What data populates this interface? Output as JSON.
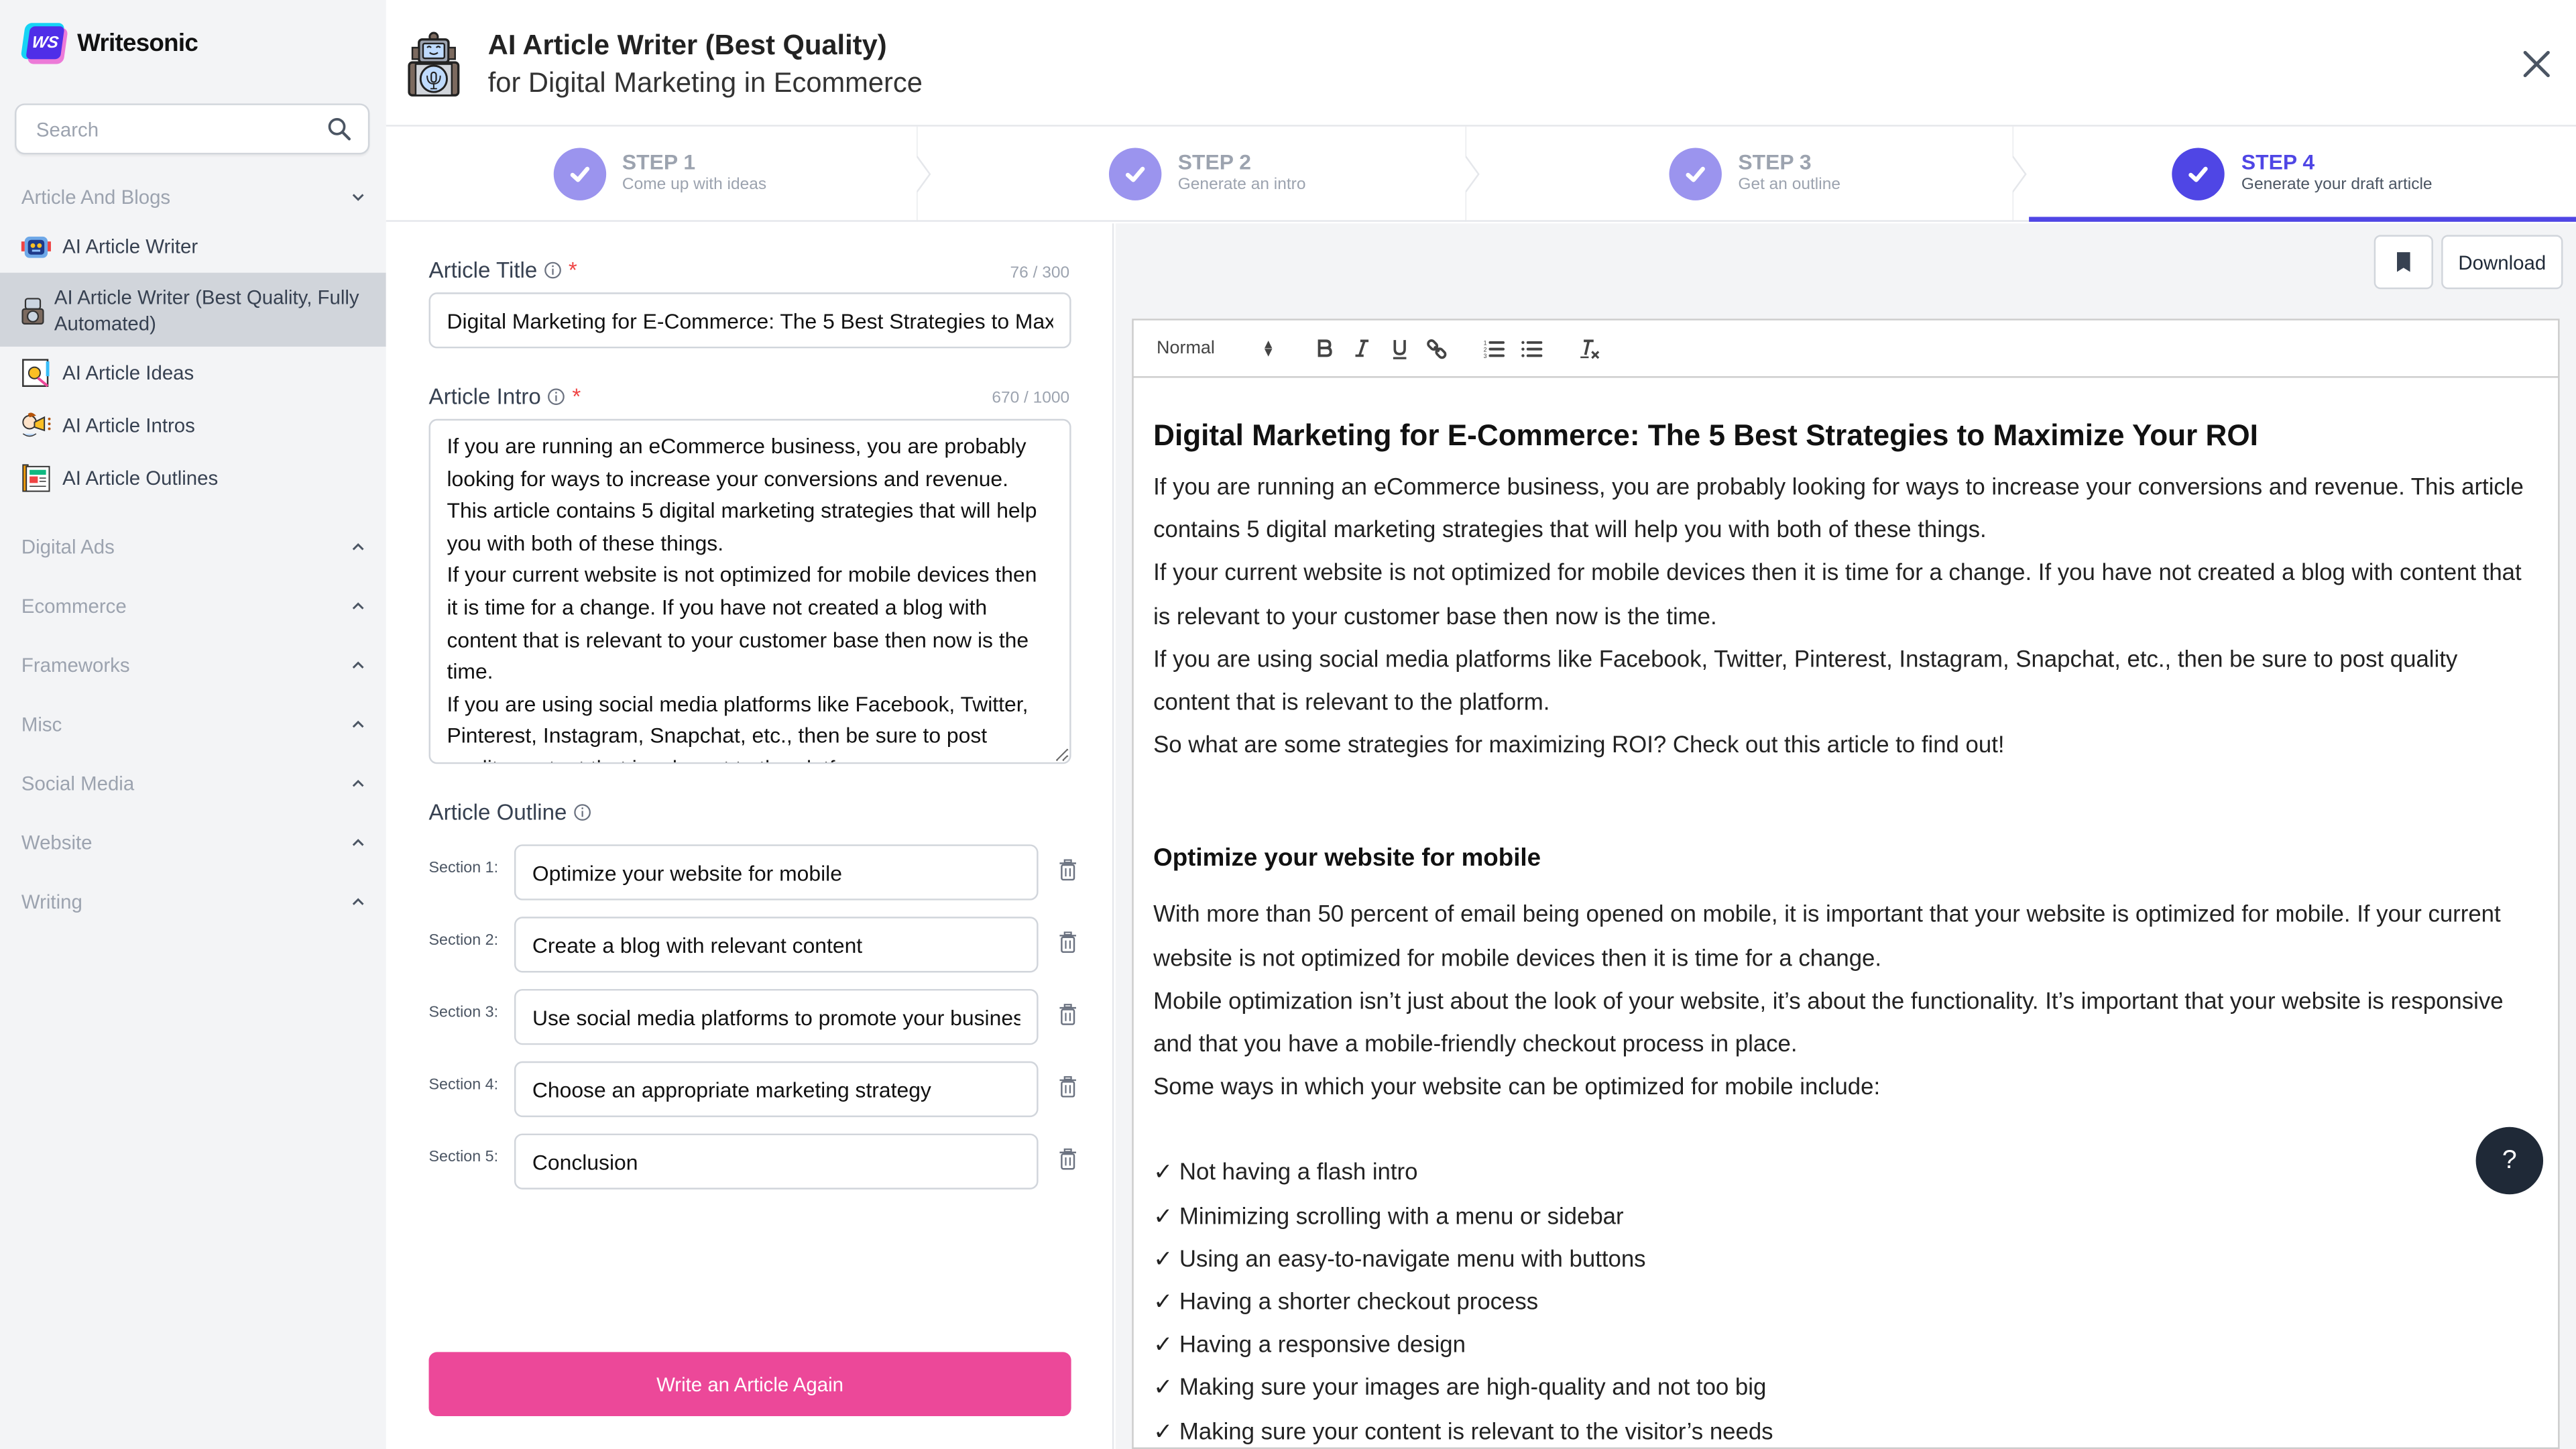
{
  "app": {
    "name": "Writesonic",
    "logo_text": "WS"
  },
  "sidebar": {
    "search_placeholder": "Search",
    "groups": [
      {
        "label": "Article And Blogs",
        "expanded": true
      },
      {
        "label": "Digital Ads",
        "expanded": false
      },
      {
        "label": "Ecommerce",
        "expanded": false
      },
      {
        "label": "Frameworks",
        "expanded": false
      },
      {
        "label": "Misc",
        "expanded": false
      },
      {
        "label": "Social Media",
        "expanded": false
      },
      {
        "label": "Website",
        "expanded": false
      },
      {
        "label": "Writing",
        "expanded": false
      }
    ],
    "items": [
      {
        "label": "AI Article Writer",
        "icon": "robot-icon"
      },
      {
        "label": "AI Article Writer (Best Quality, Fully Automated)",
        "icon": "robot-podcast-icon",
        "active": true
      },
      {
        "label": "AI Article Ideas",
        "icon": "idea-notebook-icon"
      },
      {
        "label": "AI Article Intros",
        "icon": "megaphone-icon"
      },
      {
        "label": "AI Article Outlines",
        "icon": "newspaper-icon"
      }
    ]
  },
  "header": {
    "title": "AI Article Writer (Best Quality)",
    "subtitle": "for Digital Marketing in Ecommerce"
  },
  "steps": [
    {
      "title": "STEP 1",
      "desc": "Come up with ideas",
      "done": true
    },
    {
      "title": "STEP 2",
      "desc": "Generate an intro",
      "done": true
    },
    {
      "title": "STEP 3",
      "desc": "Get an outline",
      "done": true
    },
    {
      "title": "STEP 4",
      "desc": "Generate your draft article",
      "done": true,
      "active": true
    }
  ],
  "form": {
    "title_label": "Article Title",
    "title_count": "76 / 300",
    "title_value": "Digital Marketing for E-Commerce: The 5 Best Strategies to Maximize Your ROI",
    "intro_label": "Article Intro",
    "intro_count": "670 / 1000",
    "intro_value": "If you are running an eCommerce business, you are probably looking for ways to increase your conversions and revenue. This article contains 5 digital marketing strategies that will help you with both of these things.\nIf your current website is not optimized for mobile devices then it is time for a change. If you have not created a blog with content that is relevant to your customer base then now is the time.\nIf you are using social media platforms like Facebook, Twitter, Pinterest, Instagram, Snapchat, etc., then be sure to post quality content that is relevant to the platform.\nSo what are some strategies for maximizing ROI? Check out this article to find out!",
    "outline_label": "Article Outline",
    "sections": [
      {
        "label": "Section 1:",
        "value": "Optimize your website for mobile"
      },
      {
        "label": "Section 2:",
        "value": "Create a blog with relevant content"
      },
      {
        "label": "Section 3:",
        "value": "Use social media platforms to promote your business"
      },
      {
        "label": "Section 4:",
        "value": "Choose an appropriate marketing strategy"
      },
      {
        "label": "Section 5:",
        "value": "Conclusion"
      }
    ],
    "write_again_label": "Write an Article Again"
  },
  "editor": {
    "download_label": "Download",
    "format_select": "Normal",
    "toolbar": [
      "bold",
      "italic",
      "underline",
      "link",
      "ordered-list",
      "bullet-list",
      "clear-format"
    ],
    "heading": "Digital Marketing for E-Commerce: The 5 Best Strategies to Maximize Your ROI",
    "intro_paragraphs": [
      "If you are running an eCommerce business, you are probably looking for ways to increase your conversions and revenue. This article contains 5 digital marketing strategies that will help you with both of these things.",
      "If your current website is not optimized for mobile devices then it is time for a change. If you have not created a blog with content that is relevant to your customer base then now is the time.",
      "If you are using social media platforms like Facebook, Twitter, Pinterest, Instagram, Snapchat, etc., then be sure to post quality content that is relevant to the platform.",
      "So what are some strategies for maximizing ROI? Check out this article to find out!"
    ],
    "section1_heading": "Optimize your website for mobile",
    "section1_paragraphs": [
      "With more than 50 percent of email being opened on mobile, it is important that your website is optimized for mobile. If your current website is not optimized for mobile devices then it is time for a change.",
      "Mobile optimization isn’t just about the look of your website, it’s about the functionality. It’s important that your website is responsive and that you have a mobile-friendly checkout process in place.",
      "Some ways in which your website can be optimized for mobile include:"
    ],
    "checklist": [
      "✓ Not having a flash intro",
      "✓ Minimizing scrolling with a menu or sidebar",
      "✓ Using an easy-to-navigate menu with buttons",
      "✓ Having a shorter checkout process",
      "✓ Having a responsive design",
      "✓ Making sure your images are high-quality and not too big",
      "✓ Making sure your content is relevant to the visitor’s needs"
    ]
  },
  "help_label": "?",
  "colors": {
    "accent": "#4f46e5",
    "step_done": "#9b94ee",
    "primary_button": "#ec4899",
    "help_button": "#1f2937"
  }
}
